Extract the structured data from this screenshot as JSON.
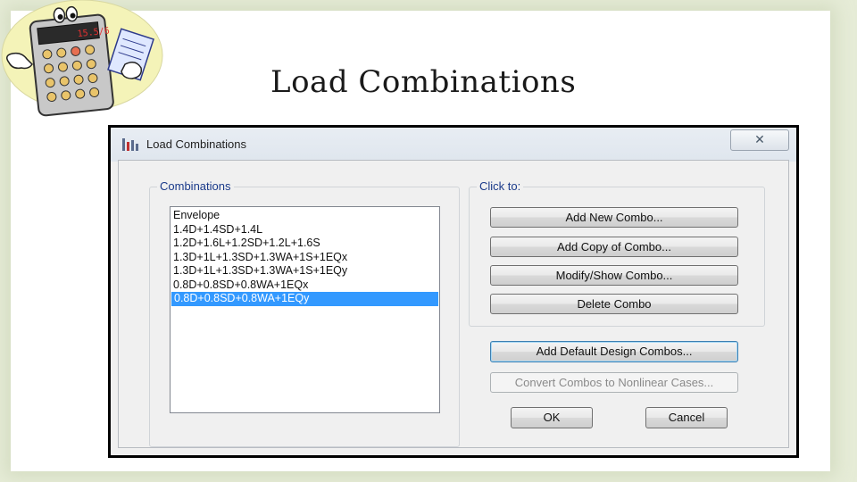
{
  "slide": {
    "title": "Load Combinations"
  },
  "logo": {
    "display_text": "15.5/6"
  },
  "dialog": {
    "title": "Load Combinations",
    "close_glyph": "✕",
    "combinations_group_label": "Combinations",
    "combinations": [
      "Envelope",
      "1.4D+1.4SD+1.4L",
      "1.2D+1.6L+1.2SD+1.2L+1.6S",
      "1.3D+1L+1.3SD+1.3WA+1S+1EQx",
      "1.3D+1L+1.3SD+1.3WA+1S+1EQy",
      "0.8D+0.8SD+0.8WA+1EQx",
      "0.8D+0.8SD+0.8WA+1EQy"
    ],
    "selected_combination": "0.8D+0.8SD+0.8WA+1EQy",
    "click_to_group_label": "Click to:",
    "buttons": {
      "add_new": "Add New Combo...",
      "add_copy": "Add Copy of Combo...",
      "modify_show": "Modify/Show Combo...",
      "delete": "Delete Combo",
      "add_default": "Add Default Design Combos...",
      "convert": "Convert Combos to Nonlinear Cases...",
      "ok": "OK",
      "cancel": "Cancel"
    }
  },
  "colors": {
    "selection": "#3399ff",
    "group_label": "#1a3a8a",
    "slide_border": "#e6ecd7"
  }
}
